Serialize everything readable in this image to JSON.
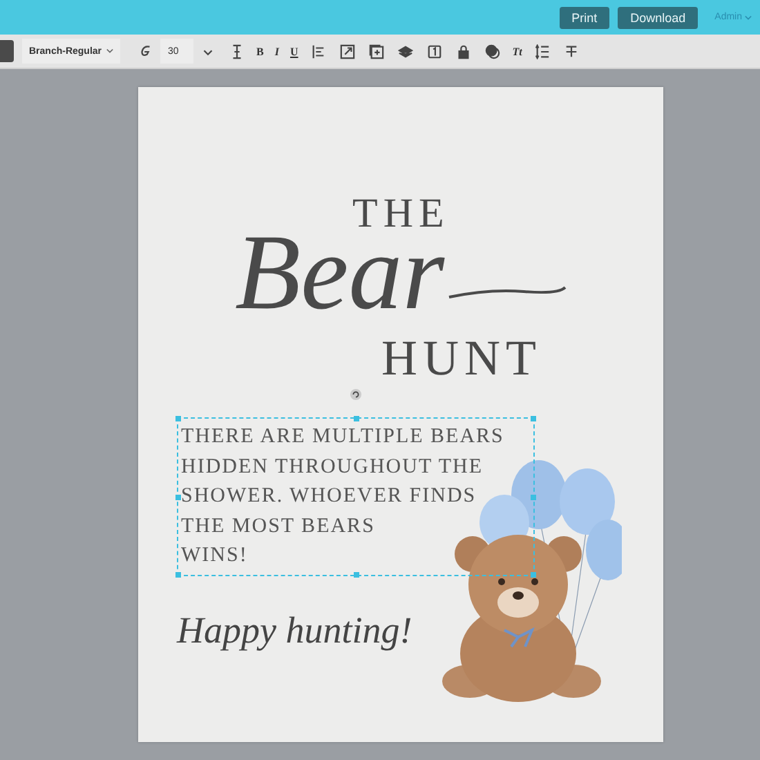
{
  "header": {
    "buttons": [
      "Print",
      "Download"
    ],
    "user_menu": "Admin"
  },
  "toolbar": {
    "font": "Branch-Regular",
    "font_size": "30",
    "format_buttons": [
      "B",
      "I",
      "U"
    ],
    "case_button": "Tt"
  },
  "document": {
    "title_top": "THE",
    "title_script": "Bear",
    "title_bottom": "HUNT",
    "body_lines": [
      "THERE ARE MULTIPLE BEARS",
      "HIDDEN THROUGHOUT THE",
      "SHOWER. WHOEVER FINDS",
      "THE MOST BEARS",
      "WINS!"
    ],
    "body_selected": true,
    "closing": "Happy hunting!"
  }
}
